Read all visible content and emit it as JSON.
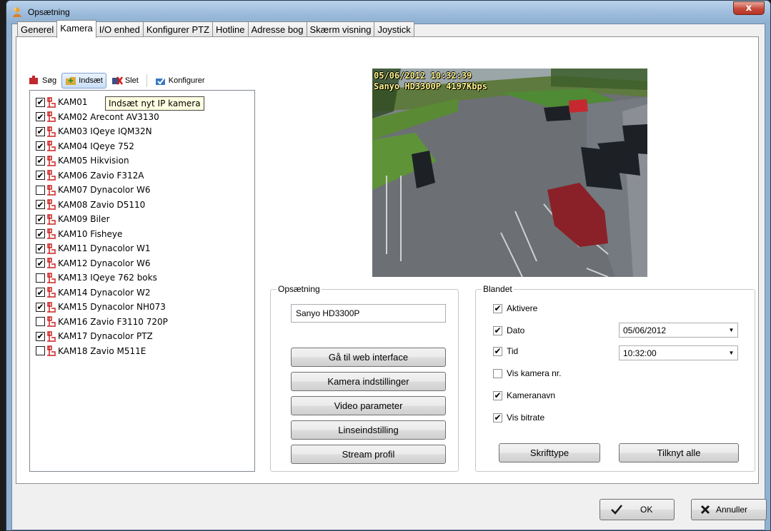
{
  "window": {
    "title": "Opsætning",
    "close_glyph": "x",
    "icon": "app-icon"
  },
  "tabs": [
    {
      "label": "Generel",
      "active": false
    },
    {
      "label": "Kamera",
      "active": true
    },
    {
      "label": "I/O enhed",
      "active": false
    },
    {
      "label": "Konfigurer PTZ",
      "active": false
    },
    {
      "label": "Hotline",
      "active": false
    },
    {
      "label": "Adresse bog",
      "active": false
    },
    {
      "label": "Skærm visning",
      "active": false
    },
    {
      "label": "Joystick",
      "active": false
    }
  ],
  "toolbar": {
    "search": {
      "label": "Søg",
      "icon": "search-camera-icon"
    },
    "insert": {
      "label": "Indsæt",
      "icon": "insert-camera-icon"
    },
    "delete": {
      "label": "Slet",
      "icon": "delete-camera-icon"
    },
    "configure": {
      "label": "Konfigurer",
      "icon": "configure-icon"
    }
  },
  "tooltip": "Indsæt nyt IP kamera",
  "cameras": [
    {
      "label": "KAM01",
      "checked": true
    },
    {
      "label": "KAM02 Arecont AV3130",
      "checked": true
    },
    {
      "label": "KAM03 IQeye IQM32N",
      "checked": true
    },
    {
      "label": "KAM04 IQeye 752",
      "checked": true
    },
    {
      "label": "KAM05 Hikvision",
      "checked": true
    },
    {
      "label": "KAM06 Zavio F312A",
      "checked": true
    },
    {
      "label": "KAM07 Dynacolor W6",
      "checked": false
    },
    {
      "label": "KAM08 Zavio D5110",
      "checked": true
    },
    {
      "label": "KAM09 Biler",
      "checked": true
    },
    {
      "label": "KAM10 Fisheye",
      "checked": true
    },
    {
      "label": "KAM11 Dynacolor W1",
      "checked": true
    },
    {
      "label": "KAM12 Dynacolor W6",
      "checked": true
    },
    {
      "label": "KAM13 IQeye 762 boks",
      "checked": false
    },
    {
      "label": "KAM14 Dynacolor W2",
      "checked": true
    },
    {
      "label": "KAM15 Dynacolor NH073",
      "checked": true
    },
    {
      "label": "KAM16 Zavio F3110 720P",
      "checked": false
    },
    {
      "label": "KAM17 Dynacolor PTZ",
      "checked": true
    },
    {
      "label": "KAM18 Zavio M511E",
      "checked": false
    }
  ],
  "preview": {
    "osd_line1": "05/06/2012 10:32:39",
    "osd_line2": "Sanyo HD3300P 4197Kbps",
    "osd_color": "#fff38a"
  },
  "setup_group": {
    "title": "Opsætning",
    "camera_name": "Sanyo HD3300P",
    "buttons": [
      "Gå til web interface",
      "Kamera indstillinger",
      "Video parameter",
      "Linseindstilling",
      "Stream profil"
    ]
  },
  "misc_group": {
    "title": "Blandet",
    "options": {
      "enable": {
        "label": "Aktivere",
        "checked": true
      },
      "date": {
        "label": "Dato",
        "checked": true
      },
      "time": {
        "label": "Tid",
        "checked": true
      },
      "cam_no": {
        "label": "Vis kamera nr.",
        "checked": false
      },
      "cam_name": {
        "label": "Kameranavn",
        "checked": true
      },
      "bitrate": {
        "label": "Vis bitrate",
        "checked": true
      }
    },
    "date_value": "05/06/2012",
    "time_value": "10:32:00",
    "font_button": "Skrifttype",
    "connect_all_button": "Tilknyt alle"
  },
  "dialog": {
    "ok": "OK",
    "cancel": "Annuller",
    "check_color": "#1a1a1a",
    "cross_color": "#1a1a1a"
  }
}
